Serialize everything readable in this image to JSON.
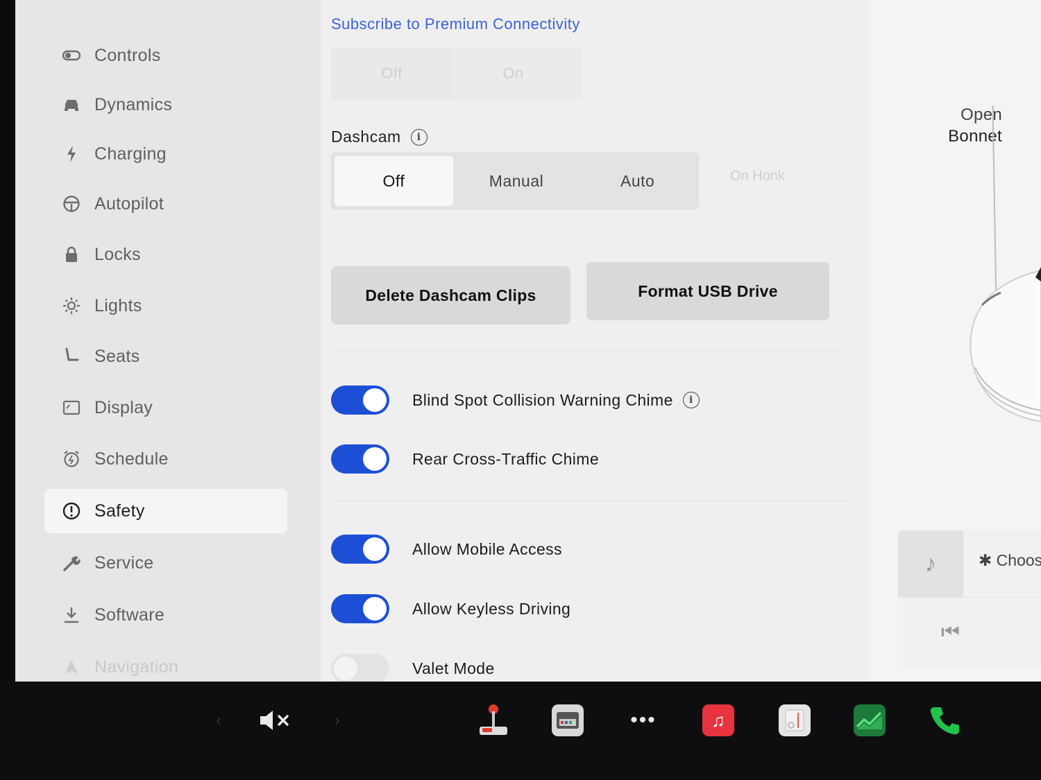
{
  "sidebar": {
    "items": [
      {
        "label": "Controls",
        "icon": "toggle-icon"
      },
      {
        "label": "Dynamics",
        "icon": "car-icon"
      },
      {
        "label": "Charging",
        "icon": "bolt-icon"
      },
      {
        "label": "Autopilot",
        "icon": "steering-wheel-icon"
      },
      {
        "label": "Locks",
        "icon": "lock-icon"
      },
      {
        "label": "Lights",
        "icon": "sun-icon"
      },
      {
        "label": "Seats",
        "icon": "seat-icon"
      },
      {
        "label": "Display",
        "icon": "display-icon"
      },
      {
        "label": "Schedule",
        "icon": "alarm-icon"
      },
      {
        "label": "Safety",
        "icon": "alert-circle-icon"
      },
      {
        "label": "Service",
        "icon": "wrench-icon"
      },
      {
        "label": "Software",
        "icon": "download-icon"
      },
      {
        "label": "Navigation",
        "icon": "navigation-icon"
      }
    ],
    "active": "Safety"
  },
  "main": {
    "premium_link": "Subscribe to Premium Connectivity",
    "top_options": [
      "Off",
      "On"
    ],
    "dashcam": {
      "label": "Dashcam",
      "options": [
        "Off",
        "Manual",
        "Auto"
      ],
      "selected": "Off",
      "on_honk": "On Honk"
    },
    "buttons": {
      "delete": "Delete Dashcam Clips",
      "format": "Format USB Drive"
    },
    "toggles": [
      {
        "label": "Blind Spot Collision Warning Chime",
        "on": true,
        "info": true
      },
      {
        "label": "Rear Cross-Traffic Chime",
        "on": true
      },
      {
        "label": "Allow Mobile Access",
        "on": true
      },
      {
        "label": "Allow Keyless Driving",
        "on": true
      },
      {
        "label": "Valet Mode",
        "on": false
      }
    ]
  },
  "car_panel": {
    "open": "Open",
    "bonnet": "Bonnet",
    "media_choose": "Choos"
  },
  "colors": {
    "accent": "#1d4fd6",
    "link": "#3b63d6"
  }
}
